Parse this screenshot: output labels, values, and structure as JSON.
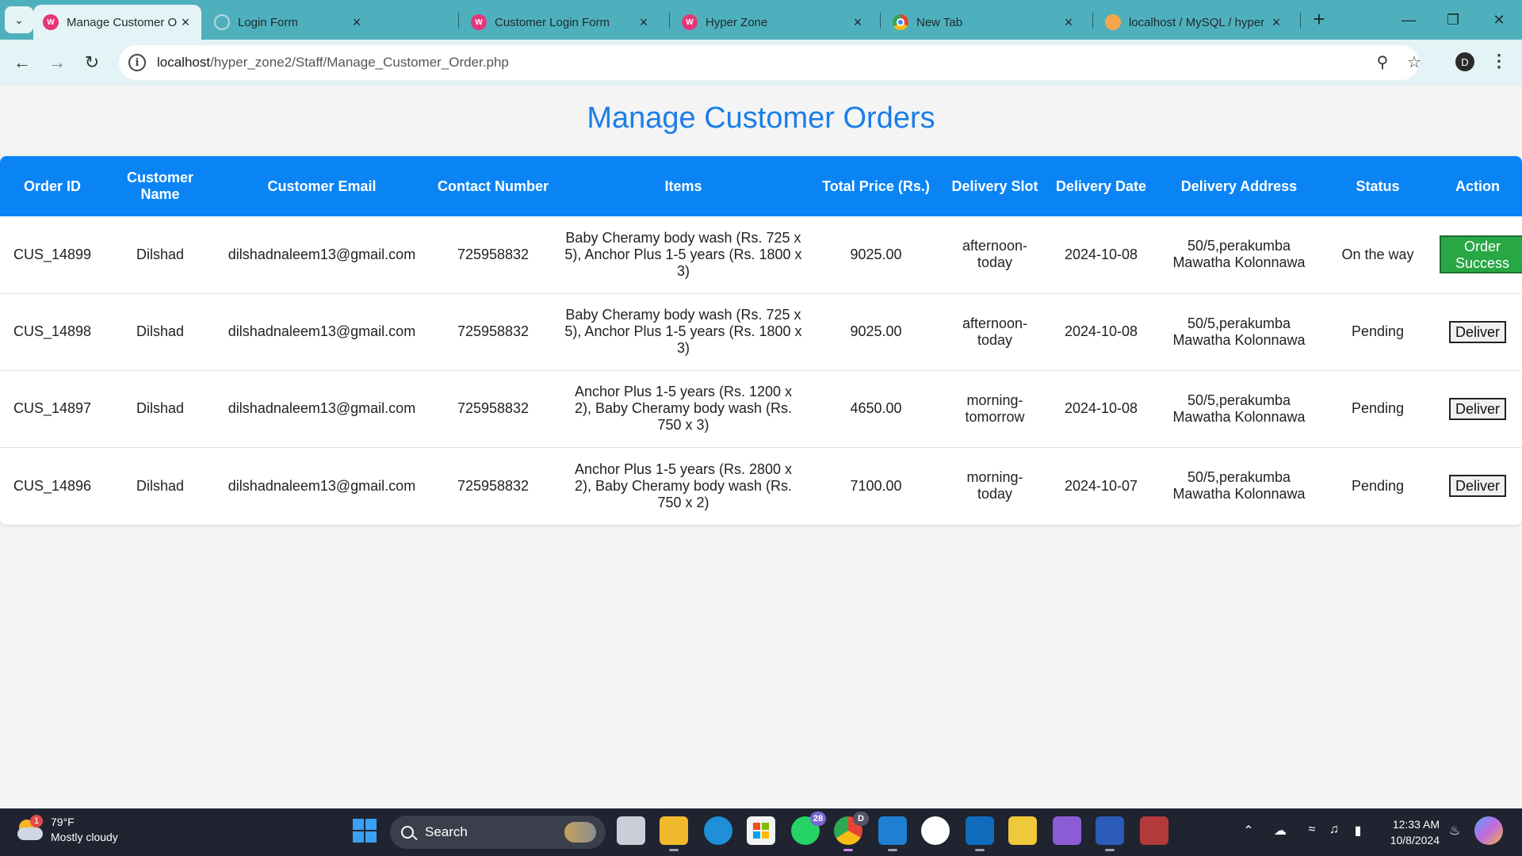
{
  "browser": {
    "tabs": [
      {
        "title": "Manage Customer Orders",
        "active": true,
        "favicon": "w3-favicon"
      },
      {
        "title": "Login Form",
        "active": false,
        "favicon": "loading-favicon"
      },
      {
        "title": "Customer Login Form",
        "active": false,
        "favicon": "w3-favicon"
      },
      {
        "title": "Hyper Zone",
        "active": false,
        "favicon": "w3-favicon"
      },
      {
        "title": "New Tab",
        "active": false,
        "favicon": "chrome-favicon"
      },
      {
        "title": "localhost / MySQL / hyper",
        "active": false,
        "favicon": "phpmyadmin-favicon"
      }
    ],
    "url_host": "localhost",
    "url_path": "/hyper_zone2/Staff/Manage_Customer_Order.php",
    "profile_initial": "D"
  },
  "page": {
    "title": "Manage Customer Orders"
  },
  "table": {
    "headers": [
      "Order ID",
      "Customer Name",
      "Customer Email",
      "Contact Number",
      "Items",
      "Total Price (Rs.)",
      "Delivery Slot",
      "Delivery Date",
      "Delivery Address",
      "Status",
      "Action"
    ],
    "rows": [
      {
        "order_id": "CUS_14899",
        "name": "Dilshad",
        "email": "dilshadnaleem13@gmail.com",
        "contact": "725958832",
        "items": "Baby Cheramy body wash (Rs. 725 x 5), Anchor Plus 1-5 years (Rs. 1800 x 3)",
        "total": "9025.00",
        "slot": "afternoon-today",
        "date": "2024-10-08",
        "address": "50/5,perakumba Mawatha Kolonnawa",
        "status": "On the way",
        "action": "Order Success"
      },
      {
        "order_id": "CUS_14898",
        "name": "Dilshad",
        "email": "dilshadnaleem13@gmail.com",
        "contact": "725958832",
        "items": "Baby Cheramy body wash (Rs. 725 x 5), Anchor Plus 1-5 years (Rs. 1800 x 3)",
        "total": "9025.00",
        "slot": "afternoon-today",
        "date": "2024-10-08",
        "address": "50/5,perakumba Mawatha Kolonnawa",
        "status": "Pending",
        "action": "Deliver"
      },
      {
        "order_id": "CUS_14897",
        "name": "Dilshad",
        "email": "dilshadnaleem13@gmail.com",
        "contact": "725958832",
        "items": "Anchor Plus 1-5 years (Rs. 1200 x 2), Baby Cheramy body wash (Rs. 750 x 3)",
        "total": "4650.00",
        "slot": "morning-tomorrow",
        "date": "2024-10-08",
        "address": "50/5,perakumba Mawatha Kolonnawa",
        "status": "Pending",
        "action": "Deliver"
      },
      {
        "order_id": "CUS_14896",
        "name": "Dilshad",
        "email": "dilshadnaleem13@gmail.com",
        "contact": "725958832",
        "items": "Anchor Plus 1-5 years (Rs. 2800 x 2), Baby Cheramy body wash (Rs. 750 x 2)",
        "total": "7100.00",
        "slot": "morning-today",
        "date": "2024-10-07",
        "address": "50/5,perakumba Mawatha Kolonnawa",
        "status": "Pending",
        "action": "Deliver"
      }
    ]
  },
  "taskbar": {
    "weather_badge": "1",
    "weather_temp": "79°F",
    "weather_desc": "Mostly cloudy",
    "search_label": "Search",
    "whatsapp_badge": "28",
    "chrome_profile_badge": "D",
    "time": "12:33 AM",
    "date": "10/8/2024"
  },
  "colors": {
    "title_blue": "#1a7ee8",
    "header_blue": "#0a84f5",
    "success_green": "#28a745",
    "tabbar_teal": "#4fb0bd"
  }
}
